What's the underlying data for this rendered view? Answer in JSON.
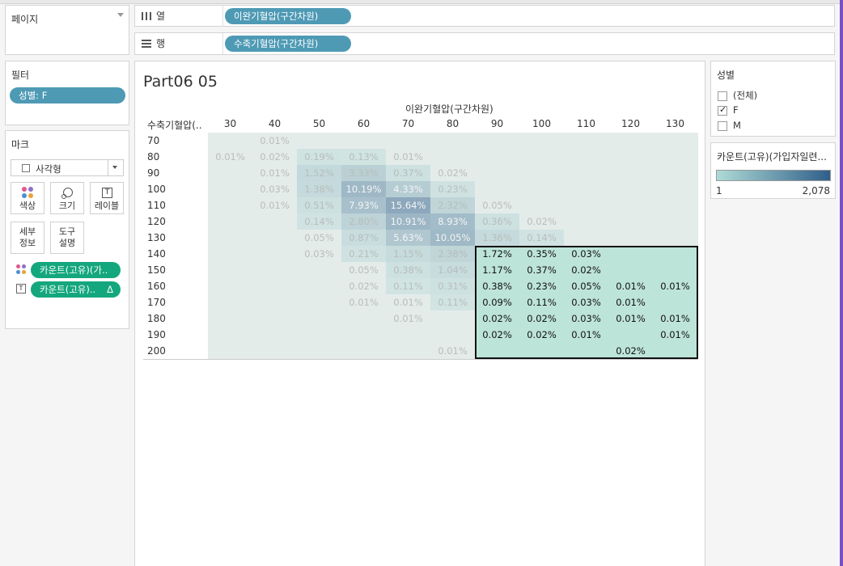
{
  "pages": {
    "title": "페이지"
  },
  "shelves": {
    "columns": {
      "label": "열",
      "icon": "columns-icon",
      "pill": "이완기혈압(구간차원)"
    },
    "rows": {
      "label": "행",
      "icon": "rows-icon",
      "pill": "수축기혈압(구간차원)"
    }
  },
  "filters": {
    "title": "필터",
    "pill": "성별: F"
  },
  "marks": {
    "title": "마크",
    "type_label": "사각형",
    "buttons": {
      "color": "색상",
      "size": "크기",
      "label": "레이블",
      "detail": "세부\n정보",
      "tooltip": "도구\n설명"
    },
    "fields": [
      {
        "text": "카운트(고유)(가..",
        "icon": "color-dots-icon"
      },
      {
        "text": "카운트(고유)..",
        "icon": "text-icon",
        "delta": "Δ"
      }
    ]
  },
  "view": {
    "title": "Part06 05",
    "column_header": "이완기혈압(구간차원)",
    "row_header": "수축기혈압(..",
    "columns": [
      "30",
      "40",
      "50",
      "60",
      "70",
      "80",
      "90",
      "100",
      "110",
      "120",
      "130"
    ],
    "rows": [
      "70",
      "80",
      "90",
      "100",
      "110",
      "120",
      "130",
      "140",
      "150",
      "160",
      "170",
      "180",
      "190",
      "200"
    ]
  },
  "chart_data": {
    "type": "heatmap",
    "title": "Part06 05",
    "xlabel": "이완기혈압(구간차원)",
    "ylabel": "수축기혈압(구간차원)",
    "x": [
      30,
      40,
      50,
      60,
      70,
      80,
      90,
      100,
      110,
      120,
      130
    ],
    "y": [
      70,
      80,
      90,
      100,
      110,
      120,
      130,
      140,
      150,
      160,
      170,
      180,
      190,
      200
    ],
    "cells": [
      {
        "r": 0,
        "c": 1,
        "v": "0.01%"
      },
      {
        "r": 1,
        "c": 0,
        "v": "0.01%"
      },
      {
        "r": 1,
        "c": 1,
        "v": "0.02%"
      },
      {
        "r": 1,
        "c": 2,
        "v": "0.19%"
      },
      {
        "r": 1,
        "c": 3,
        "v": "0.13%"
      },
      {
        "r": 1,
        "c": 4,
        "v": "0.01%"
      },
      {
        "r": 2,
        "c": 1,
        "v": "0.01%"
      },
      {
        "r": 2,
        "c": 2,
        "v": "1.52%"
      },
      {
        "r": 2,
        "c": 3,
        "v": "3.33%"
      },
      {
        "r": 2,
        "c": 4,
        "v": "0.37%"
      },
      {
        "r": 2,
        "c": 5,
        "v": "0.02%"
      },
      {
        "r": 3,
        "c": 1,
        "v": "0.03%"
      },
      {
        "r": 3,
        "c": 2,
        "v": "1.38%"
      },
      {
        "r": 3,
        "c": 3,
        "v": "10.19%"
      },
      {
        "r": 3,
        "c": 4,
        "v": "4.33%"
      },
      {
        "r": 3,
        "c": 5,
        "v": "0.23%"
      },
      {
        "r": 4,
        "c": 1,
        "v": "0.01%"
      },
      {
        "r": 4,
        "c": 2,
        "v": "0.51%"
      },
      {
        "r": 4,
        "c": 3,
        "v": "7.93%"
      },
      {
        "r": 4,
        "c": 4,
        "v": "15.64%"
      },
      {
        "r": 4,
        "c": 5,
        "v": "2.32%"
      },
      {
        "r": 4,
        "c": 6,
        "v": "0.05%"
      },
      {
        "r": 5,
        "c": 2,
        "v": "0.14%"
      },
      {
        "r": 5,
        "c": 3,
        "v": "2.80%"
      },
      {
        "r": 5,
        "c": 4,
        "v": "10.91%"
      },
      {
        "r": 5,
        "c": 5,
        "v": "8.93%"
      },
      {
        "r": 5,
        "c": 6,
        "v": "0.36%"
      },
      {
        "r": 5,
        "c": 7,
        "v": "0.02%"
      },
      {
        "r": 6,
        "c": 2,
        "v": "0.05%"
      },
      {
        "r": 6,
        "c": 3,
        "v": "0.87%"
      },
      {
        "r": 6,
        "c": 4,
        "v": "5.63%"
      },
      {
        "r": 6,
        "c": 5,
        "v": "10.05%"
      },
      {
        "r": 6,
        "c": 6,
        "v": "1.36%"
      },
      {
        "r": 6,
        "c": 7,
        "v": "0.14%"
      },
      {
        "r": 7,
        "c": 2,
        "v": "0.03%"
      },
      {
        "r": 7,
        "c": 3,
        "v": "0.21%"
      },
      {
        "r": 7,
        "c": 4,
        "v": "1.15%"
      },
      {
        "r": 7,
        "c": 5,
        "v": "2.38%"
      },
      {
        "r": 7,
        "c": 6,
        "v": "1.72%"
      },
      {
        "r": 7,
        "c": 7,
        "v": "0.35%"
      },
      {
        "r": 7,
        "c": 8,
        "v": "0.03%"
      },
      {
        "r": 8,
        "c": 3,
        "v": "0.05%"
      },
      {
        "r": 8,
        "c": 4,
        "v": "0.38%"
      },
      {
        "r": 8,
        "c": 5,
        "v": "1.04%"
      },
      {
        "r": 8,
        "c": 6,
        "v": "1.17%"
      },
      {
        "r": 8,
        "c": 7,
        "v": "0.37%"
      },
      {
        "r": 8,
        "c": 8,
        "v": "0.02%"
      },
      {
        "r": 9,
        "c": 3,
        "v": "0.02%"
      },
      {
        "r": 9,
        "c": 4,
        "v": "0.11%"
      },
      {
        "r": 9,
        "c": 5,
        "v": "0.31%"
      },
      {
        "r": 9,
        "c": 6,
        "v": "0.38%"
      },
      {
        "r": 9,
        "c": 7,
        "v": "0.23%"
      },
      {
        "r": 9,
        "c": 8,
        "v": "0.05%"
      },
      {
        "r": 9,
        "c": 9,
        "v": "0.01%"
      },
      {
        "r": 9,
        "c": 10,
        "v": "0.01%"
      },
      {
        "r": 10,
        "c": 3,
        "v": "0.01%"
      },
      {
        "r": 10,
        "c": 4,
        "v": "0.01%"
      },
      {
        "r": 10,
        "c": 5,
        "v": "0.11%"
      },
      {
        "r": 10,
        "c": 6,
        "v": "0.09%"
      },
      {
        "r": 10,
        "c": 7,
        "v": "0.11%"
      },
      {
        "r": 10,
        "c": 8,
        "v": "0.03%"
      },
      {
        "r": 10,
        "c": 9,
        "v": "0.01%"
      },
      {
        "r": 11,
        "c": 4,
        "v": "0.01%"
      },
      {
        "r": 11,
        "c": 6,
        "v": "0.02%"
      },
      {
        "r": 11,
        "c": 7,
        "v": "0.02%"
      },
      {
        "r": 11,
        "c": 8,
        "v": "0.03%"
      },
      {
        "r": 11,
        "c": 9,
        "v": "0.01%"
      },
      {
        "r": 11,
        "c": 10,
        "v": "0.01%"
      },
      {
        "r": 12,
        "c": 6,
        "v": "0.02%"
      },
      {
        "r": 12,
        "c": 7,
        "v": "0.02%"
      },
      {
        "r": 12,
        "c": 8,
        "v": "0.01%"
      },
      {
        "r": 12,
        "c": 10,
        "v": "0.01%"
      },
      {
        "r": 13,
        "c": 5,
        "v": "0.01%"
      },
      {
        "r": 13,
        "c": 9,
        "v": "0.02%"
      }
    ],
    "selection": {
      "rows": [
        140,
        200
      ],
      "cols": [
        90,
        130
      ]
    },
    "colors": {
      "background": "#e4ecea",
      "highlight": "#bde4d8",
      "dark": "#2f5f8a",
      "light": "#aedbd6"
    }
  },
  "gender_filter": {
    "title": "성별",
    "options": [
      {
        "label": "(전체)",
        "checked": false
      },
      {
        "label": "F",
        "checked": true
      },
      {
        "label": "M",
        "checked": false
      }
    ]
  },
  "color_legend": {
    "title": "카운트(고유)(가입자일련...",
    "min": "1",
    "max": "2,078"
  }
}
